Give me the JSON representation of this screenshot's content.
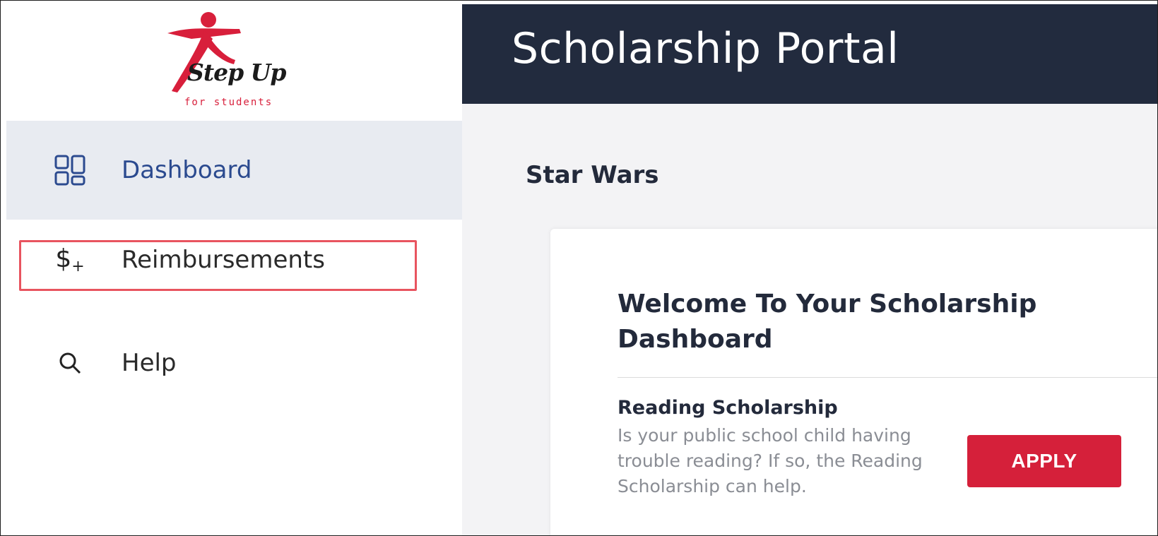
{
  "logo": {
    "brand_text": "Step Up",
    "sub_text": "for students",
    "brand_color": "#d81f3b"
  },
  "header": {
    "title": "Scholarship Portal",
    "background": "#222b3e"
  },
  "sidebar": {
    "items": [
      {
        "label": "Dashboard",
        "icon": "dashboard-grid-icon",
        "active": true
      },
      {
        "label": "Reimbursements",
        "icon": "dollar-plus-icon",
        "highlighted": true
      },
      {
        "label": "Help",
        "icon": "search-icon"
      }
    ]
  },
  "main": {
    "student_name": "Star Wars",
    "card": {
      "heading": "Welcome To Your Scholarship Dashboard",
      "program": {
        "title": "Reading Scholarship",
        "description": "Is your public school child having trouble reading? If so, the Reading Scholarship can help.",
        "button_label": "APPLY",
        "button_color": "#d5203a"
      }
    }
  }
}
